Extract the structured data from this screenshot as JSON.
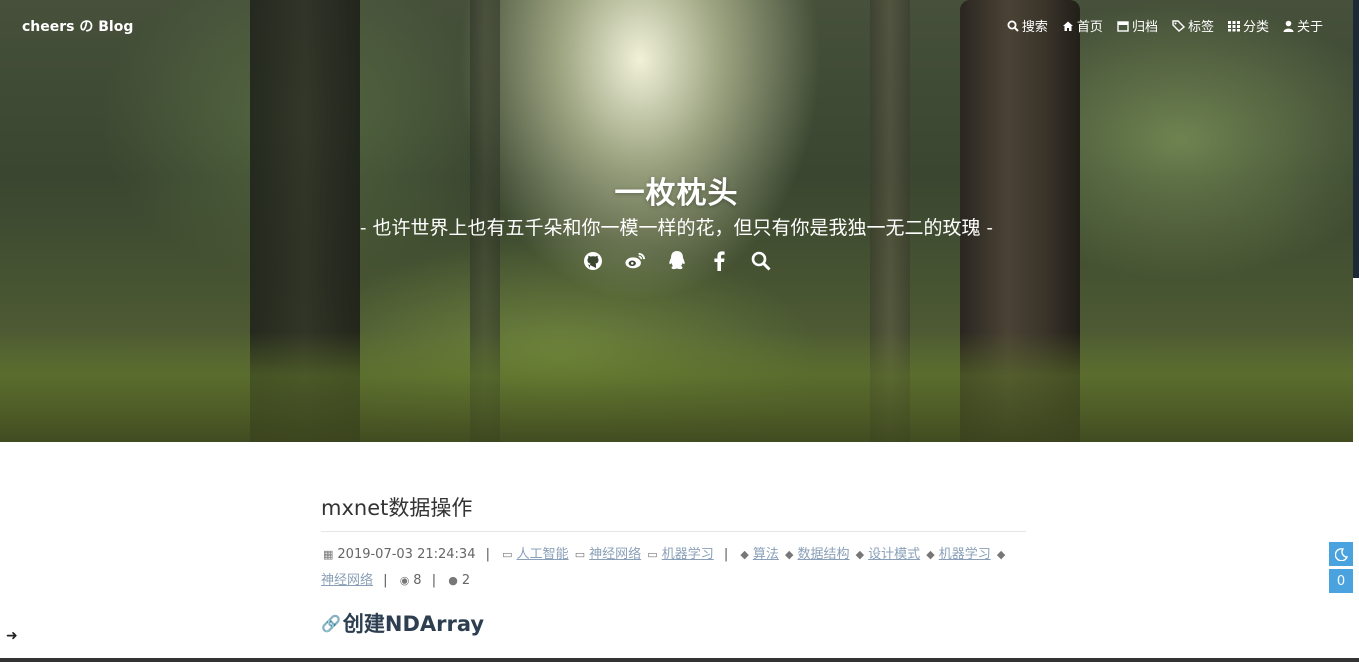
{
  "header": {
    "brand": "cheers の Blog",
    "nav": [
      {
        "label": "搜索",
        "icon": "search-icon"
      },
      {
        "label": "首页",
        "icon": "home-icon"
      },
      {
        "label": "归档",
        "icon": "archive-icon"
      },
      {
        "label": "标签",
        "icon": "tags-icon"
      },
      {
        "label": "分类",
        "icon": "grid-icon"
      },
      {
        "label": "关于",
        "icon": "user-icon"
      }
    ],
    "site_title": "一枚枕头",
    "site_subtitle": "- 也许世界上也有五千朵和你一模一样的花，但只有你是我独一无二的玫瑰 -",
    "social_icons": [
      "github-icon",
      "weibo-icon",
      "qq-icon",
      "facebook-icon",
      "search-icon"
    ]
  },
  "post": {
    "title": "mxnet数据操作",
    "datetime": "2019-07-03 21:24:34",
    "categories": [
      "人工智能",
      "神经网络",
      "机器学习"
    ],
    "tags": [
      "算法",
      "数据结构",
      "设计模式",
      "机器学习",
      "神经网络"
    ],
    "views": "8",
    "comments": "2",
    "section_heading": "创建NDArray"
  },
  "floating": {
    "dark_mode_icon": "moon-icon",
    "comment_count": "0"
  },
  "colors": {
    "accent": "#4aa3df",
    "link": "#8aa0b8",
    "heading": "#2c3e50",
    "anchor_icon": "#e25f5f"
  }
}
